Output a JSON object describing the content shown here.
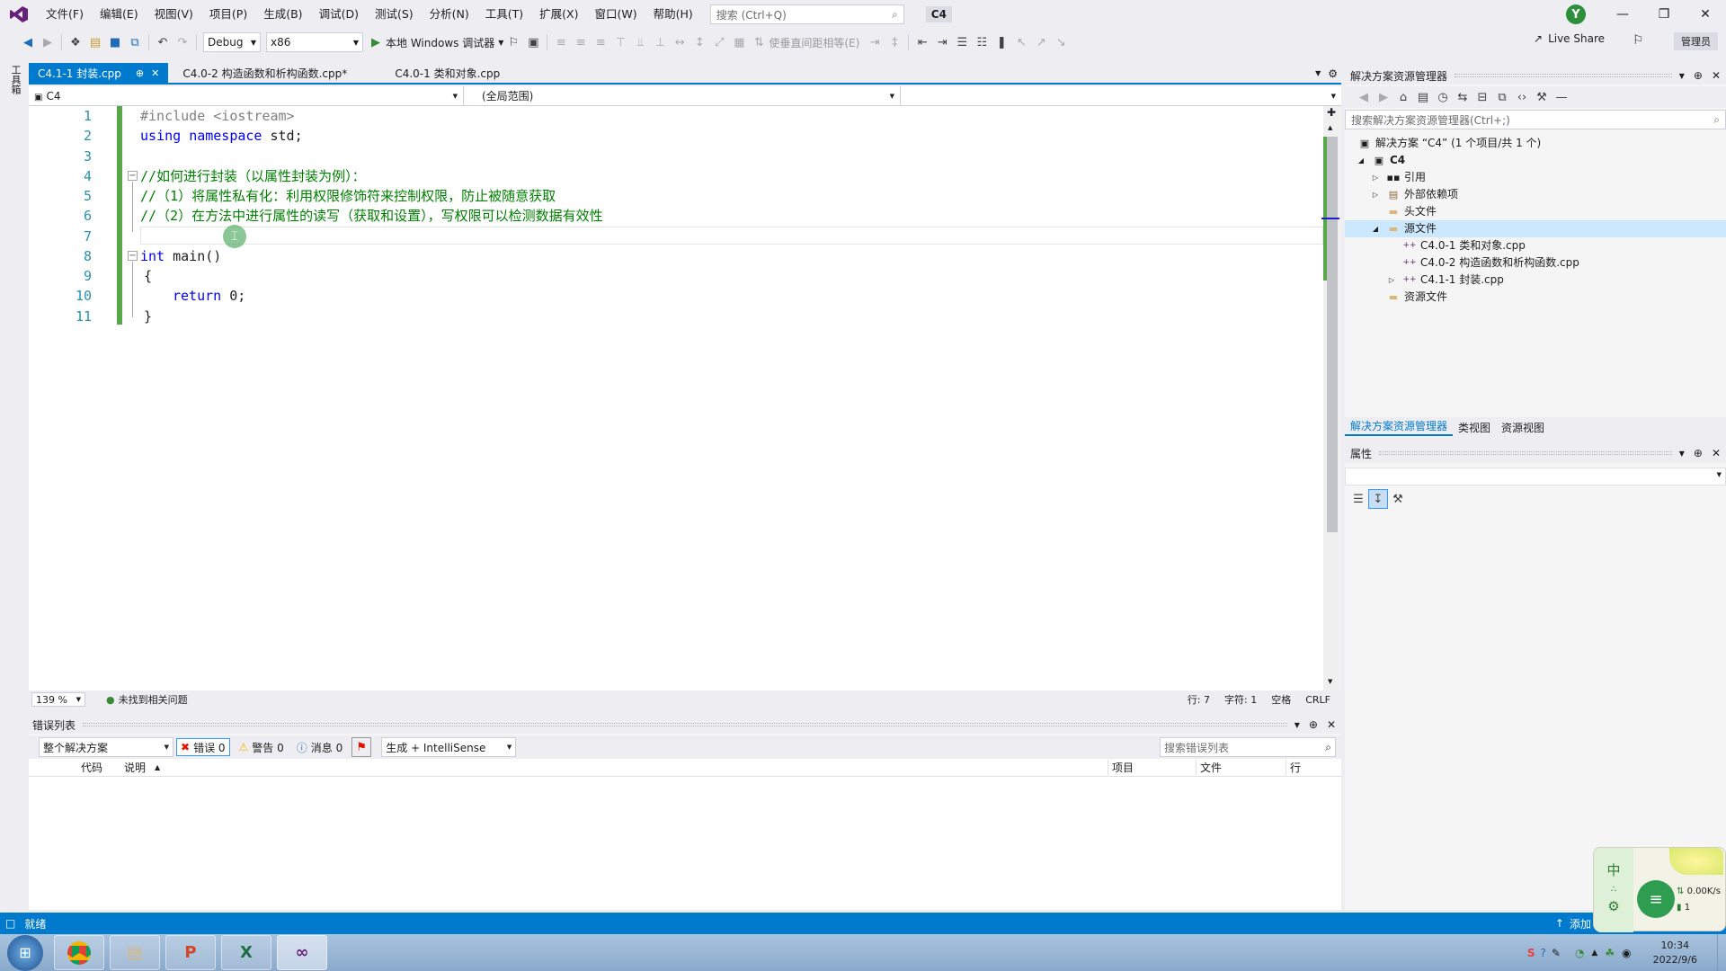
{
  "menu": {
    "items": [
      "文件(F)",
      "编辑(E)",
      "视图(V)",
      "项目(P)",
      "生成(B)",
      "调试(D)",
      "测试(S)",
      "分析(N)",
      "工具(T)",
      "扩展(X)",
      "窗口(W)",
      "帮助(H)"
    ],
    "search_placeholder": "搜索 (Ctrl+Q)",
    "solution_name": "C4",
    "user_initial": "Y"
  },
  "toolbar": {
    "config": "Debug",
    "platform": "x86",
    "debugger": "本地 Windows 调试器",
    "align_hint": "使垂直间距相等(E)",
    "live_share": "Live Share",
    "admin": "管理员"
  },
  "left_strip": {
    "label": "工具箱"
  },
  "tabs": [
    {
      "label": "C4.1-1 封装.cpp",
      "active": true
    },
    {
      "label": "C4.0-2 构造函数和析构函数.cpp*",
      "active": false
    },
    {
      "label": "C4.0-1 类和对象.cpp",
      "active": false
    }
  ],
  "navbar": {
    "project": "C4",
    "scope": "(全局范围)",
    "member": ""
  },
  "editor": {
    "line_numbers": [
      "1",
      "2",
      "3",
      "4",
      "5",
      "6",
      "7",
      "8",
      "9",
      "10",
      "11"
    ],
    "lines": {
      "l1_pp": "#include ",
      "l1_str": "<iostream>",
      "l2_kw1": "using",
      "l2_kw2": "namespace",
      "l2_rest": " std;",
      "l4": "//如何进行封装（以属性封装为例）：",
      "l5": "//（1）将属性私有化：利用权限修饰符来控制权限，防止被随意获取",
      "l6": "//（2）在方法中进行属性的读写（获取和设置），写权限可以检测数据有效性",
      "l8_kw": "int",
      "l8_rest": " main()",
      "l9": "{",
      "l10_kw": "return",
      "l10_rest": " 0;",
      "l11": "}"
    }
  },
  "editor_status": {
    "zoom": "139 %",
    "issues": "未找到相关问题",
    "line": "行: 7",
    "char": "字符: 1",
    "spaces": "空格",
    "eol": "CRLF"
  },
  "error_list": {
    "title": "错误列表",
    "scope": "整个解决方案",
    "errors": "错误 0",
    "warnings": "警告 0",
    "messages": "消息 0",
    "build_filter": "生成 + IntelliSense",
    "search_placeholder": "搜索错误列表",
    "columns": [
      "代码",
      "说明",
      "项目",
      "文件",
      "行"
    ]
  },
  "solution_explorer": {
    "title": "解决方案资源管理器",
    "search_placeholder": "搜索解决方案资源管理器(Ctrl+;)",
    "solution_label": "解决方案 “C4” (1 个项目/共 1 个)",
    "project": "C4",
    "nodes": {
      "references": "引用",
      "external": "外部依赖项",
      "headers": "头文件",
      "sources": "源文件",
      "f1": "C4.0-1 类和对象.cpp",
      "f2": "C4.0-2 构造函数和析构函数.cpp",
      "f3": "C4.1-1 封装.cpp",
      "resources": "资源文件"
    },
    "bottom_tabs": [
      "解决方案资源管理器",
      "类视图",
      "资源视图"
    ]
  },
  "properties": {
    "title": "属性"
  },
  "statusbar": {
    "ready": "就绪",
    "add": "添加"
  },
  "tray": {
    "time": "10:34",
    "date": "2022/9/6",
    "net_speed": "0.00K/s",
    "net_count": "1",
    "ime": "中"
  },
  "colors": {
    "accent": "#007acc",
    "comment": "#008000",
    "keyword": "#0000ff",
    "line_number": "#2b91af",
    "vs_purple": "#68217a"
  }
}
